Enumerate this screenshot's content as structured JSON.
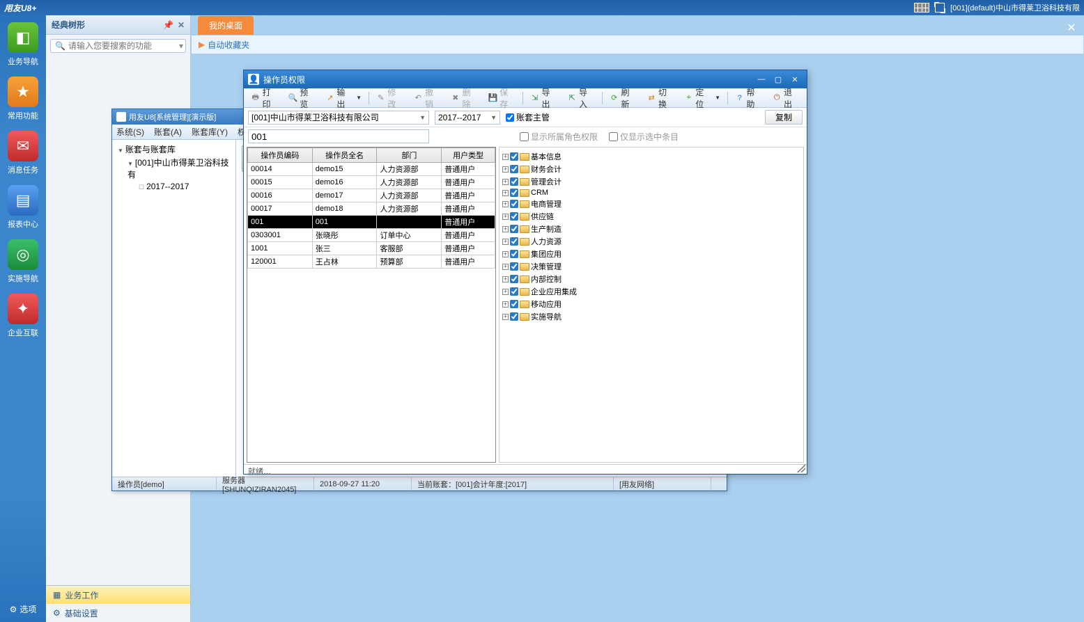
{
  "titlebar": {
    "brand": "用友U8+",
    "org": "[001](default)中山市得莱卫浴科技有限"
  },
  "rail": {
    "items": [
      {
        "label": "业务导航",
        "glyph": "◧"
      },
      {
        "label": "常用功能",
        "glyph": "★"
      },
      {
        "label": "消息任务",
        "glyph": "✉"
      },
      {
        "label": "报表中心",
        "glyph": "▤"
      },
      {
        "label": "实施导航",
        "glyph": "◎"
      },
      {
        "label": "企业互联",
        "glyph": "✦"
      }
    ],
    "options": "选项"
  },
  "sidepanel": {
    "title": "经典树形",
    "search_placeholder": "请输入您要搜索的功能",
    "footer": [
      {
        "label": "业务工作",
        "glyph": "▦",
        "active": true
      },
      {
        "label": "基础设置",
        "glyph": "⚙",
        "active": false
      }
    ]
  },
  "tab": {
    "label": "我的桌面"
  },
  "favorites": "自动收藏夹",
  "sysWindow": {
    "title": "用友U8[系统管理][演示版]",
    "menu": [
      "系统(S)",
      "账套(A)",
      "账套库(Y)",
      "权限"
    ],
    "tree": {
      "root": "账套与账套库",
      "node": "[001]中山市得莱卫浴科技有",
      "leaf": "2017--2017"
    },
    "status": {
      "operator": "操作员[demo]",
      "server": "服务器[SHUNQIZIRAN2045]",
      "time": "2018-09-27 11:20",
      "account": "当前账套：[001]会计年度:[2017]",
      "net": "[用友网络]"
    }
  },
  "dialog": {
    "title": "操作员权限",
    "toolbar": {
      "print": "打印",
      "preview": "预览",
      "output": "输出",
      "modify": "修改",
      "undo": "撤销",
      "delete": "删除",
      "save": "保存",
      "export": "导出",
      "import": "导入",
      "refresh": "刷新",
      "switch": "切换",
      "locate": "定位",
      "help": "帮助",
      "exit": "退出"
    },
    "filters": {
      "account": "[001]中山市得莱卫浴科技有限公司",
      "year": "2017--2017",
      "chk_master": "账套主管",
      "search_value": "001",
      "chk_roles": "显示所属角色权限",
      "chk_selected": "仅显示选中条目",
      "copy": "复制"
    },
    "grid": {
      "headers": [
        "操作员编码",
        "操作员全名",
        "部门",
        "用户类型"
      ],
      "rows": [
        {
          "code": "00014",
          "name": "demo15",
          "dept": "人力资源部",
          "type": "普通用户"
        },
        {
          "code": "00015",
          "name": "demo16",
          "dept": "人力资源部",
          "type": "普通用户"
        },
        {
          "code": "00016",
          "name": "demo17",
          "dept": "人力资源部",
          "type": "普通用户"
        },
        {
          "code": "00017",
          "name": "demo18",
          "dept": "人力资源部",
          "type": "普通用户"
        },
        {
          "code": "001",
          "name": "001",
          "dept": "",
          "type": "普通用户",
          "selected": true
        },
        {
          "code": "0303001",
          "name": "张晓彤",
          "dept": "订单中心",
          "type": "普通用户"
        },
        {
          "code": "1001",
          "name": "张三",
          "dept": "客服部",
          "type": "普通用户"
        },
        {
          "code": "120001",
          "name": "王占林",
          "dept": "预算部",
          "type": "普通用户"
        }
      ]
    },
    "perms": [
      "基本信息",
      "财务会计",
      "管理会计",
      "CRM",
      "电商管理",
      "供应链",
      "生产制造",
      "人力资源",
      "集团应用",
      "决策管理",
      "内部控制",
      "企业应用集成",
      "移动应用",
      "实施导航"
    ],
    "status": "就绪…"
  }
}
